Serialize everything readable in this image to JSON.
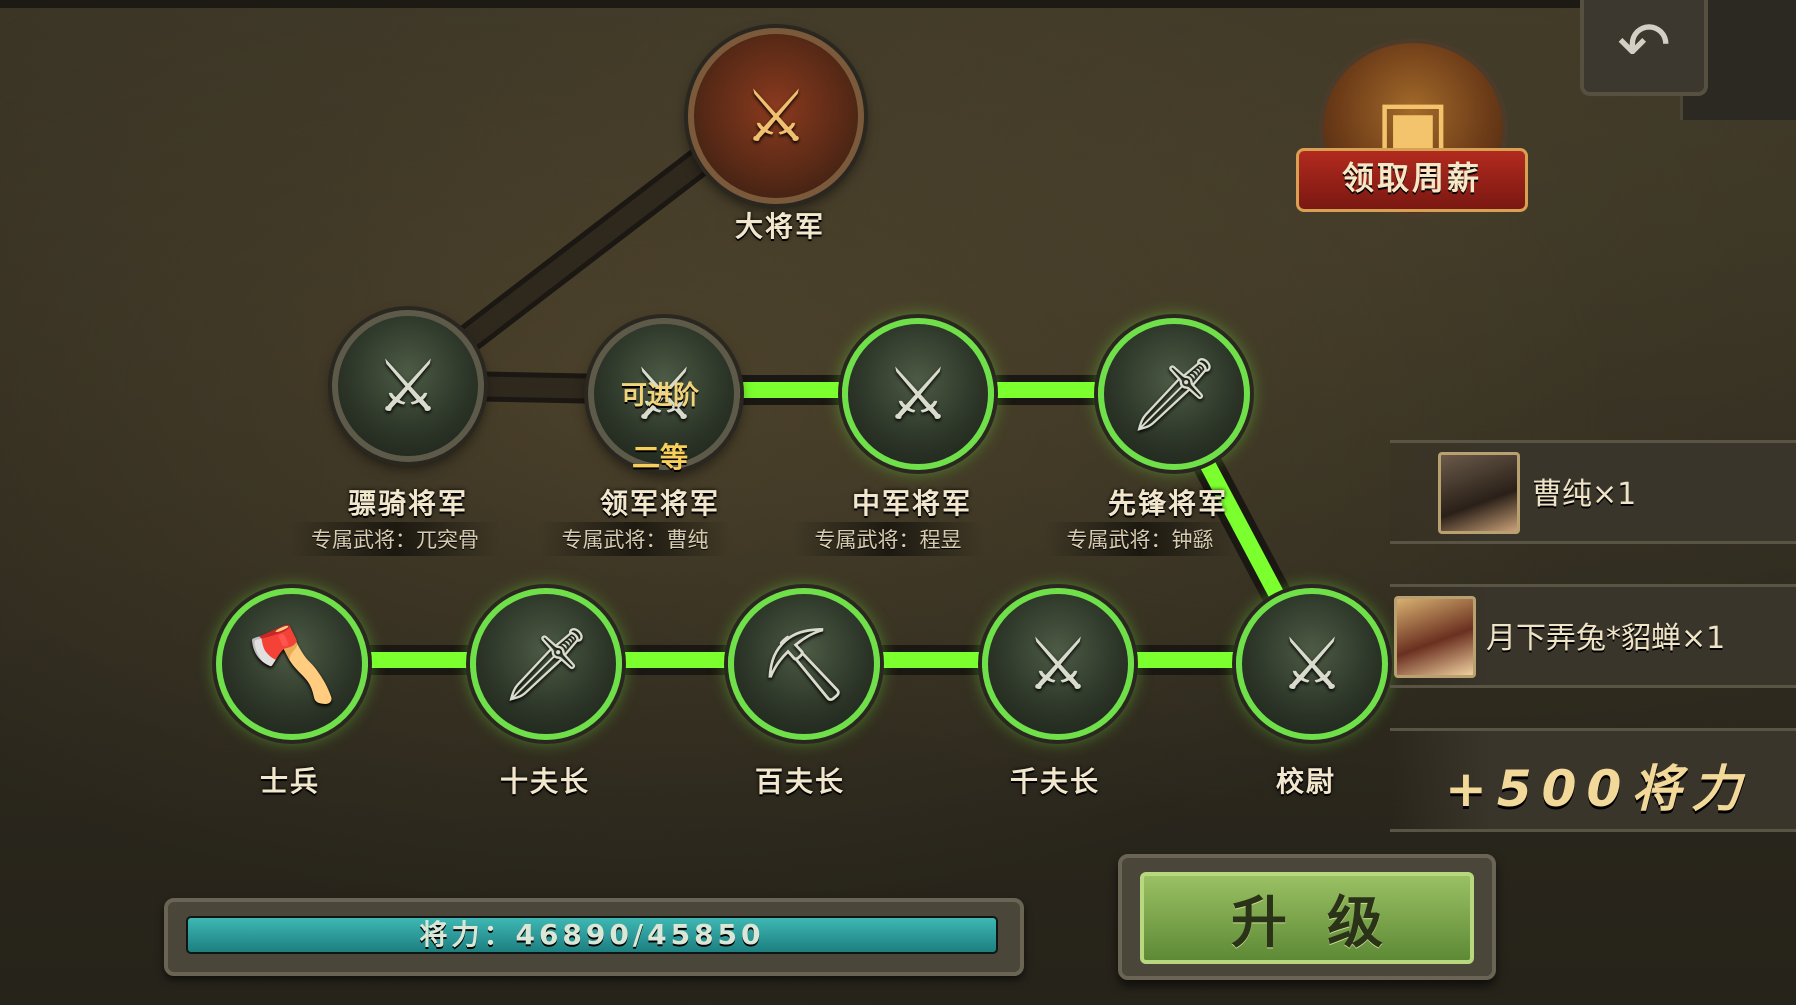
{
  "top_rank": {
    "label": "大将军",
    "icon": "crossed-axes-emblem-icon"
  },
  "weekly_salary": {
    "label": "领取周薪",
    "icon": "treasure-chest-icon"
  },
  "back_button": {
    "icon": "back-arrow-icon",
    "glyph": "↶"
  },
  "general_ranks": [
    {
      "label": "骠骑将军",
      "exclusive": "专属武将：兀突骨",
      "icon": "triple-sword-icon",
      "glyph": "⚔",
      "lit": false
    },
    {
      "label": "领军将军",
      "exclusive": "专属武将：曹纯",
      "icon": "triple-sword-icon",
      "glyph": "⚔",
      "lit": false,
      "advance": "可进阶",
      "grade": "二等"
    },
    {
      "label": "中军将军",
      "exclusive": "专属武将：程昱",
      "icon": "crossed-swords-icon",
      "glyph": "⚔",
      "lit": true
    },
    {
      "label": "先锋将军",
      "exclusive": "专属武将：钟繇",
      "icon": "single-sword-icon",
      "glyph": "🗡",
      "lit": true
    }
  ],
  "basic_ranks": [
    {
      "label": "士兵",
      "icon": "axe-icon",
      "glyph": "🪓",
      "lit": true
    },
    {
      "label": "十夫长",
      "icon": "spear-icon",
      "glyph": "🗡",
      "lit": true
    },
    {
      "label": "百夫长",
      "icon": "pickaxe-icon",
      "glyph": "⛏",
      "lit": true
    },
    {
      "label": "千夫长",
      "icon": "glaive-icon",
      "glyph": "⚔",
      "lit": true
    },
    {
      "label": "校尉",
      "icon": "halberd-icon",
      "glyph": "⚔",
      "lit": true
    }
  ],
  "rewards": [
    {
      "text": "曹纯×1",
      "avatar": "cao-chun-avatar"
    },
    {
      "text": "月下弄兔*貂蝉×1",
      "avatar": "diaochan-avatar"
    },
    {
      "text": "+500将力"
    }
  ],
  "power": {
    "text": "将力：46890/45850",
    "current": 46890,
    "max": 45850,
    "fill_ratio": 1.0
  },
  "upgrade_button": {
    "label": "升级"
  },
  "colors": {
    "path_lit": "#7cff2e",
    "path_dim": "#2a2418",
    "accent_gold": "#f2d47a"
  }
}
